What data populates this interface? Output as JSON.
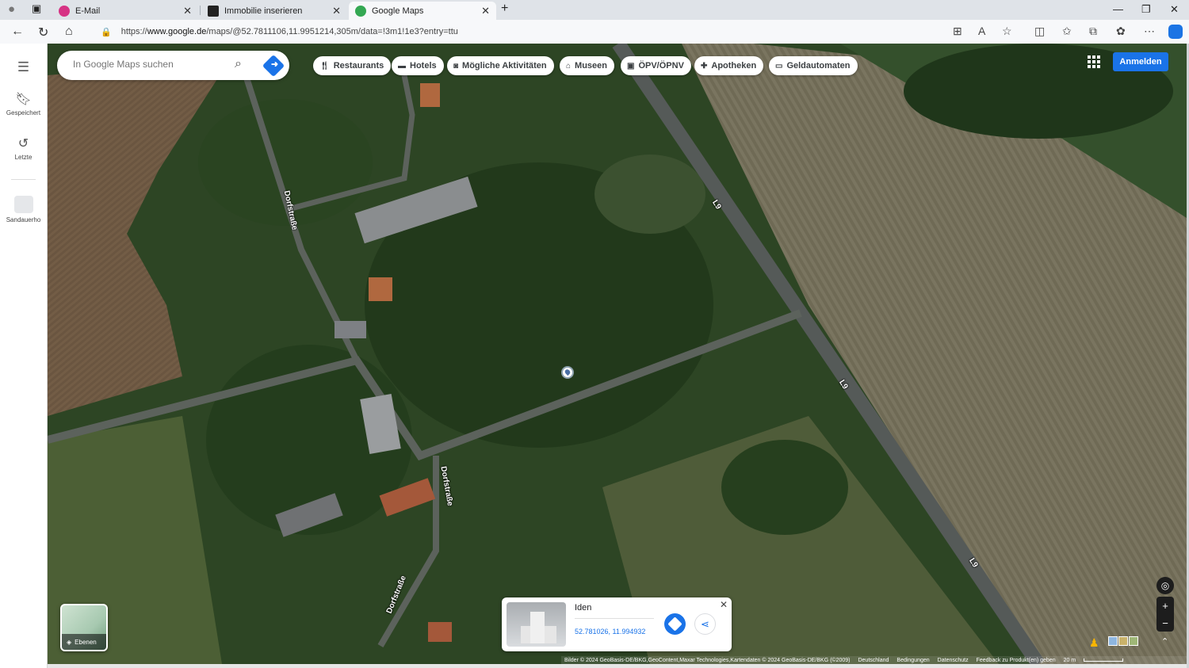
{
  "browser": {
    "tabs": [
      {
        "title": "E-Mail"
      },
      {
        "title": "Immobilie inserieren"
      },
      {
        "title": "Google Maps"
      }
    ],
    "url_prefix": "https://",
    "url_domain": "www.google.de",
    "url_rest": "/maps/@52.7811106,11.9951214,305m/data=!3m1!1e3?entry=ttu"
  },
  "rail": {
    "menu_icon": "hamburger-icon",
    "items": [
      {
        "label": "Gespeichert",
        "icon": "bookmark-icon"
      },
      {
        "label": "Letzte",
        "icon": "history-icon"
      },
      {
        "label": "Sandauerho",
        "icon": "place-thumbnail-icon"
      }
    ]
  },
  "search": {
    "placeholder": "In Google Maps suchen"
  },
  "chips": [
    {
      "label": "Restaurants",
      "icon": "restaurant-icon"
    },
    {
      "label": "Hotels",
      "icon": "hotel-icon"
    },
    {
      "label": "Mögliche Aktivitäten",
      "icon": "camera-icon"
    },
    {
      "label": "Museen",
      "icon": "museum-icon"
    },
    {
      "label": "ÖPV/ÖPNV",
      "icon": "transit-icon"
    },
    {
      "label": "Apotheken",
      "icon": "pharmacy-icon"
    },
    {
      "label": "Geldautomaten",
      "icon": "atm-icon"
    }
  ],
  "header": {
    "signin_label": "Anmelden"
  },
  "map": {
    "road_labels": [
      "Dorfstraße",
      "Dorfstraße",
      "Dorfstraße",
      "L9",
      "L9",
      "L9"
    ]
  },
  "layers": {
    "label": "Ebenen"
  },
  "card": {
    "name": "Iden",
    "coords": "52.781026, 11.994932"
  },
  "footer": {
    "attribution": "Bilder © 2024 GeoBasis-DE/BKG,GeoContent,Maxar Technologies,Kartendaten © 2024 GeoBasis-DE/BKG (©2009)",
    "country": "Deutschland",
    "terms": "Bedingungen",
    "privacy": "Datenschutz",
    "feedback": "Feedback zu Produkt(en) geben",
    "scale": "20 m"
  },
  "colors": {
    "accent": "#1a73e8",
    "chrome_bg": "#dfe3e8"
  }
}
